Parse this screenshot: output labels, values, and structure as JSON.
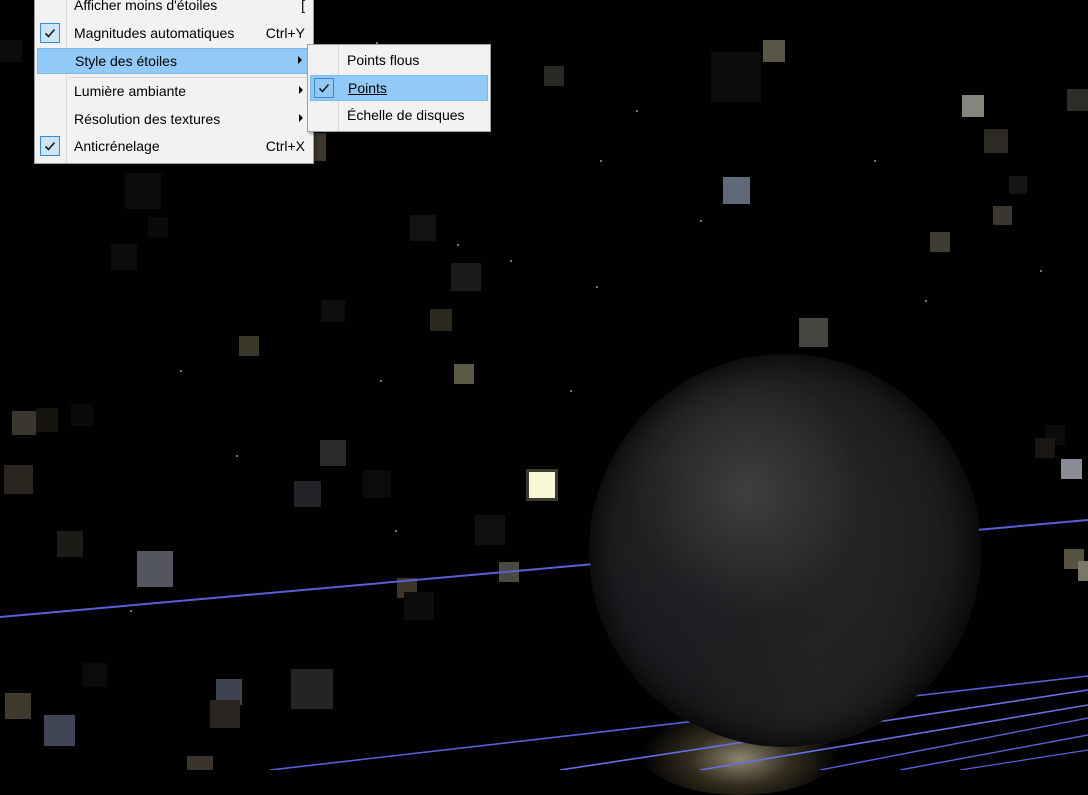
{
  "menu": {
    "items": [
      {
        "label": "Afficher moins d'étoiles",
        "shortcut": "[",
        "checked": false,
        "submenu": false
      },
      {
        "label": "Magnitudes automatiques",
        "shortcut": "Ctrl+Y",
        "checked": true,
        "submenu": false
      },
      {
        "label": "Style des étoiles",
        "shortcut": "",
        "checked": false,
        "submenu": true,
        "highlighted": true
      },
      {
        "label": "Lumière ambiante",
        "shortcut": "",
        "checked": false,
        "submenu": true
      },
      {
        "label": "Résolution des textures",
        "shortcut": "",
        "checked": false,
        "submenu": true
      },
      {
        "label": "Anticrénelage",
        "shortcut": "Ctrl+X",
        "checked": true,
        "submenu": false
      }
    ]
  },
  "submenu": {
    "items": [
      {
        "label": "Points flous",
        "checked": false
      },
      {
        "label": "Points",
        "checked": true,
        "highlighted": true
      },
      {
        "label": "Échelle de disques",
        "checked": false
      }
    ]
  },
  "colors": {
    "menu_bg": "#f2f2f2",
    "highlight": "#91c9f7",
    "check_border": "#3c88d6",
    "orbit_line": "#5b5fd6"
  },
  "icons": {
    "check": "check-icon",
    "submenu": "chevron-right-icon"
  }
}
